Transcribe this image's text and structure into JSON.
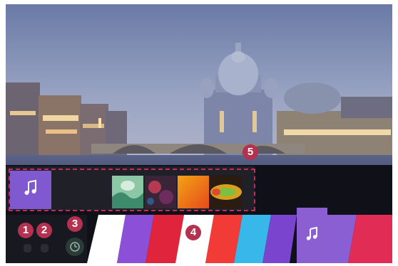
{
  "callouts": {
    "one": "1",
    "two": "2",
    "three": "3",
    "four": "4",
    "five": "5"
  },
  "icons": {
    "preview_app": "music-note-icon",
    "launcher_app": "music-note-icon",
    "recent": "history-icon"
  },
  "colors": {
    "callout": "#b3324f",
    "selection_border": "#c22d5a",
    "music_app": "#8058d0",
    "launcher_stripes": [
      "#ffffff",
      "#8c50d8",
      "#e0243c",
      "#ffffff",
      "#f23a36",
      "#38b8ea",
      "#7a44cf",
      "#8a5fd4",
      "#e12c56"
    ]
  }
}
